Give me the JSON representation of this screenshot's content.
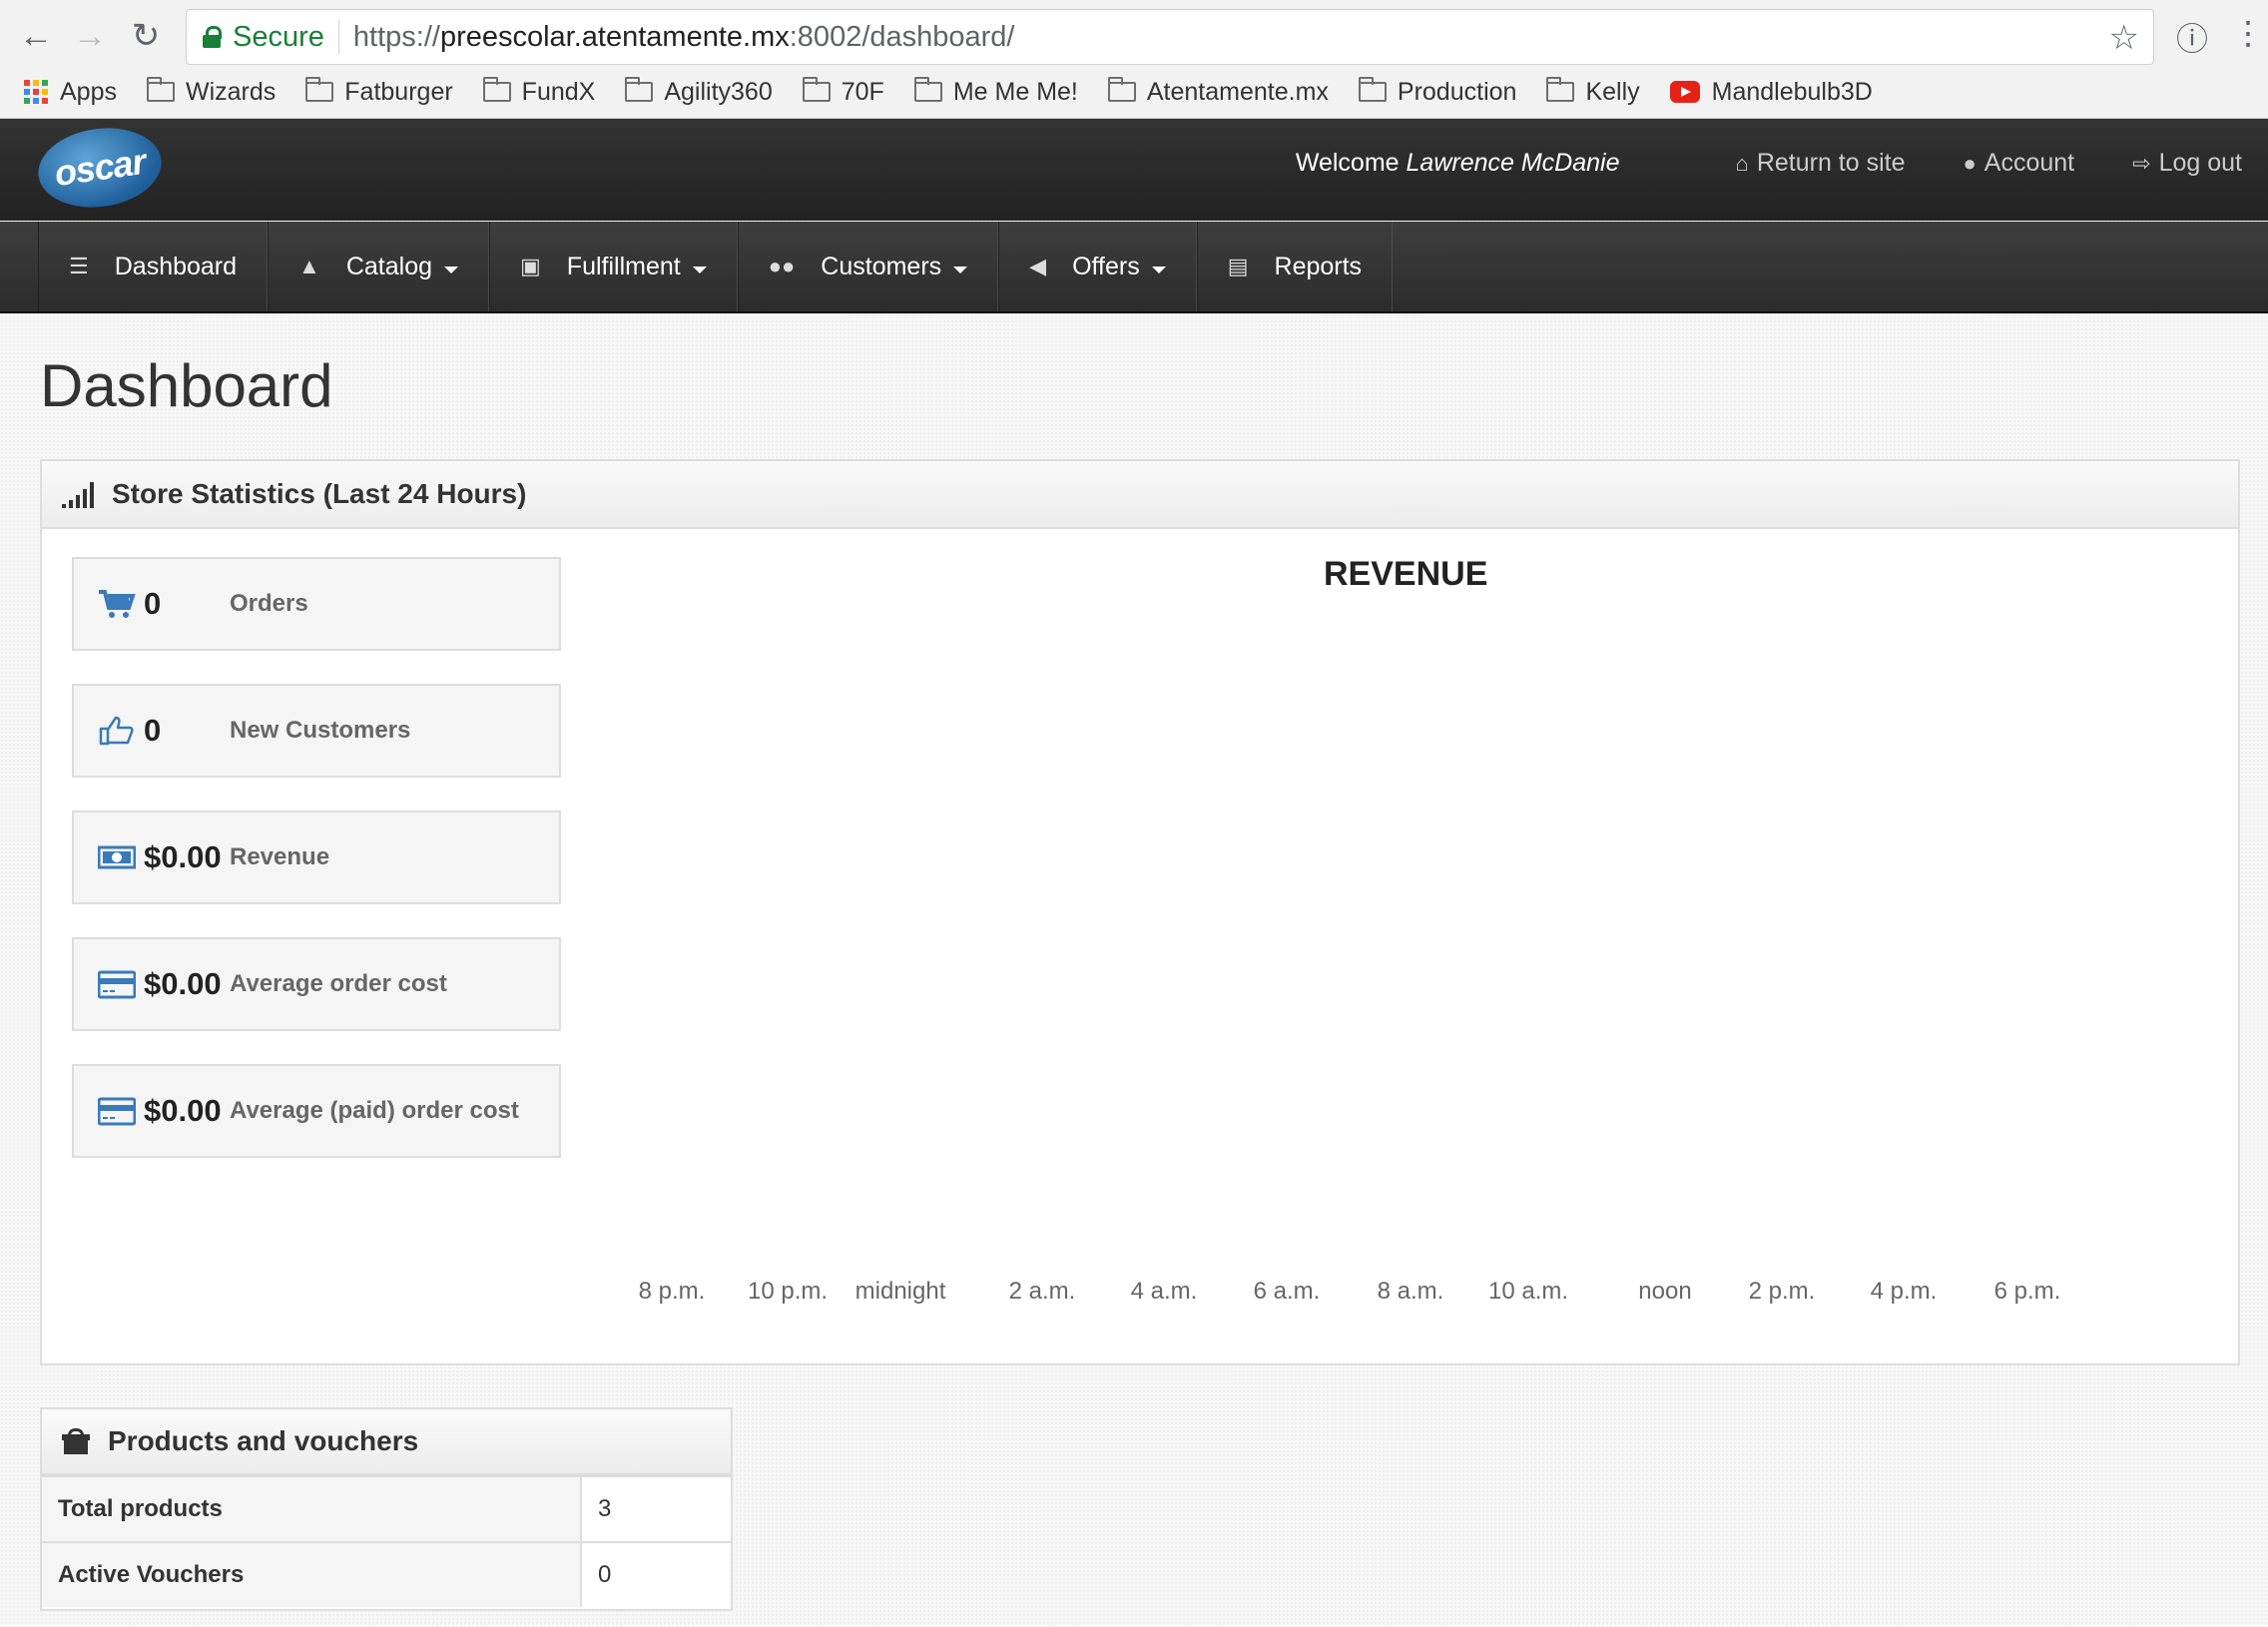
{
  "browser": {
    "secure_label": "Secure",
    "url_scheme": "https://",
    "url_host": "preescolar.atentamente.mx",
    "url_rest": ":8002/dashboard/",
    "bookmarks": [
      {
        "label": "Apps",
        "icon": "apps-grid-icon"
      },
      {
        "label": "Wizards",
        "icon": "folder-icon"
      },
      {
        "label": "Fatburger",
        "icon": "folder-icon"
      },
      {
        "label": "FundX",
        "icon": "folder-icon"
      },
      {
        "label": "Agility360",
        "icon": "folder-icon"
      },
      {
        "label": "70F",
        "icon": "folder-icon"
      },
      {
        "label": "Me Me Me!",
        "icon": "folder-icon"
      },
      {
        "label": "Atentamente.mx",
        "icon": "folder-icon"
      },
      {
        "label": "Production",
        "icon": "folder-icon"
      },
      {
        "label": "Kelly",
        "icon": "folder-icon"
      },
      {
        "label": "Mandlebulb3D",
        "icon": "youtube-icon"
      }
    ]
  },
  "header": {
    "logo_text": "oscar",
    "welcome_prefix": "Welcome",
    "user_name": "Lawrence McDanie",
    "return_label": "Return to site",
    "account_label": "Account",
    "logout_label": "Log out"
  },
  "nav": {
    "dashboard": "Dashboard",
    "catalog": "Catalog",
    "fulfillment": "Fulfillment",
    "customers": "Customers",
    "offers": "Offers",
    "reports": "Reports"
  },
  "page_title": "Dashboard",
  "stats_panel": {
    "title": "Store Statistics (Last 24 Hours)",
    "orders": {
      "value": "0",
      "label": "Orders"
    },
    "new_customers": {
      "value": "0",
      "label": "New Customers"
    },
    "revenue": {
      "value": "$0.00",
      "label": "Revenue"
    },
    "avg_order": {
      "value": "$0.00",
      "label": "Average order cost"
    },
    "avg_paid_order": {
      "value": "$0.00",
      "label": "Average (paid) order cost"
    }
  },
  "chart_data": {
    "type": "bar",
    "title": "REVENUE",
    "categories": [
      "8 p.m.",
      "10 p.m.",
      "midnight",
      "2 a.m.",
      "4 a.m.",
      "6 a.m.",
      "8 a.m.",
      "10 a.m.",
      "noon",
      "2 p.m.",
      "4 p.m.",
      "6 p.m."
    ],
    "values": [
      0,
      0,
      0,
      0,
      0,
      0,
      0,
      0,
      0,
      0,
      0,
      0
    ],
    "xlabel": "",
    "ylabel": ""
  },
  "products_panel": {
    "title": "Products and vouchers",
    "rows": [
      {
        "label": "Total products",
        "value": "3"
      },
      {
        "label": "Active Vouchers",
        "value": "0"
      }
    ]
  },
  "colors": {
    "accent_blue": "#3a7ab8",
    "secure_green": "#188038",
    "header_dark": "#2a2a2a"
  }
}
